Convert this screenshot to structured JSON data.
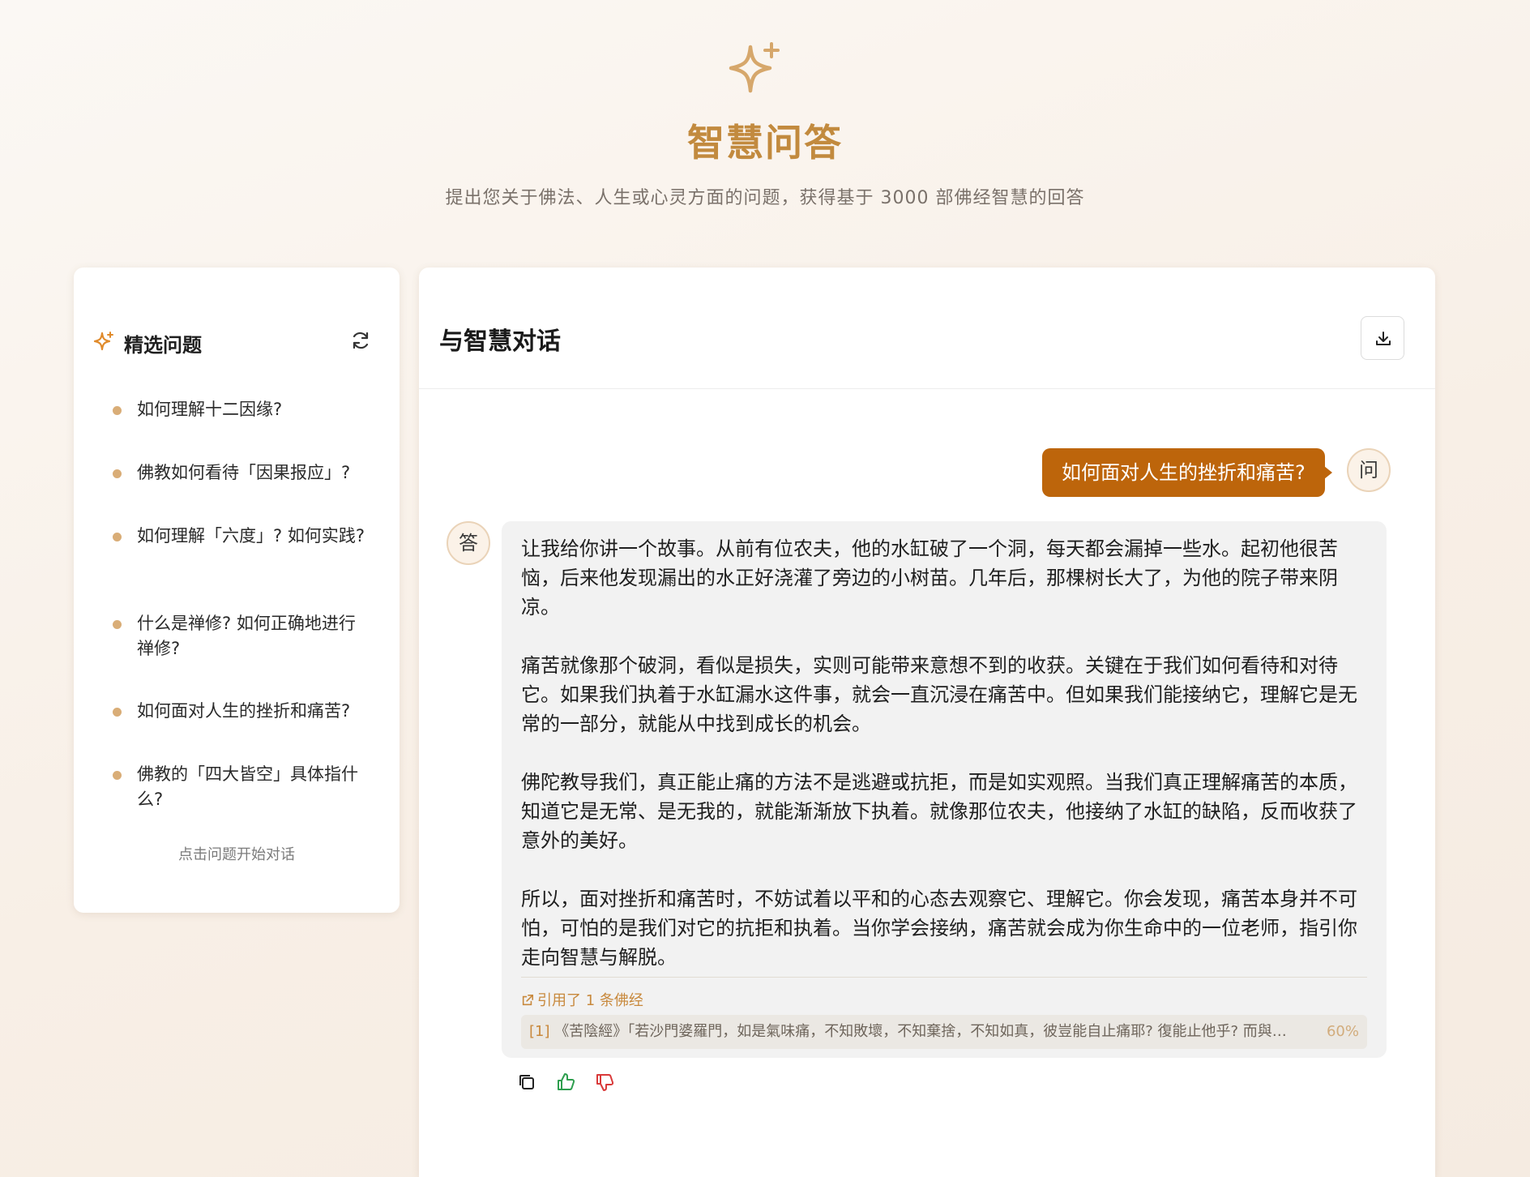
{
  "hero": {
    "icon": "sparkle-icon",
    "title": "智慧问答",
    "subtitle": "提出您关于佛法、人生或心灵方面的问题，获得基于 3000 部佛经智慧的回答",
    "accent_color": "#c28a3e"
  },
  "sidebar": {
    "icon": "sparkle-icon",
    "title": "精选问题",
    "refresh_icon": "refresh-icon",
    "questions": [
      "如何理解十二因缘?",
      "佛教如何看待「因果报应」?",
      "如何理解「六度」? 如何实践?",
      "什么是禅修? 如何正确地进行禅修?",
      "如何面对人生的挫折和痛苦?",
      "佛教的「四大皆空」具体指什么?"
    ],
    "hint": "点击问题开始对话"
  },
  "chat": {
    "title": "与智慧对话",
    "download_icon": "download-icon",
    "user_avatar": "问",
    "bot_avatar": "答",
    "question": "如何面对人生的挫折和痛苦?",
    "question_color": "#bd650b",
    "answer_paragraphs": [
      "让我给你讲一个故事。从前有位农夫，他的水缸破了一个洞，每天都会漏掉一些水。起初他很苦恼，后来他发现漏出的水正好浇灌了旁边的小树苗。几年后，那棵树长大了，为他的院子带来阴凉。",
      "痛苦就像那个破洞，看似是损失，实则可能带来意想不到的收获。关键在于我们如何看待和对待它。如果我们执着于水缸漏水这件事，就会一直沉浸在痛苦中。但如果我们能接纳它，理解它是无常的一部分，就能从中找到成长的机会。",
      "佛陀教导我们，真正能止痛的方法不是逃避或抗拒，而是如实观照。当我们真正理解痛苦的本质，知道它是无常、是无我的，就能渐渐放下执着。就像那位农夫，他接纳了水缸的缺陷，反而收获了意外的美好。",
      "所以，面对挫折和痛苦时，不妨试着以平和的心态去观察它、理解它。你会发现，痛苦本身并不可怕，可怕的是我们对它的抗拒和执着。当你学会接纳，痛苦就会成为你生命中的一位老师，指引你走向智慧与解脱。"
    ],
    "citation_label": "引用了 1 条佛经",
    "citation": {
      "index": "[1]",
      "text": "《苦陰經》「若沙門婆羅門，如是氣味痛，不知敗壞，不知棄捨，不知如真，彼豈能自止痛耶? 復能止他乎? 而與住...",
      "relevance": "60%"
    },
    "actions": [
      "copy-icon",
      "thumbs-up-icon",
      "thumbs-down-icon"
    ]
  }
}
